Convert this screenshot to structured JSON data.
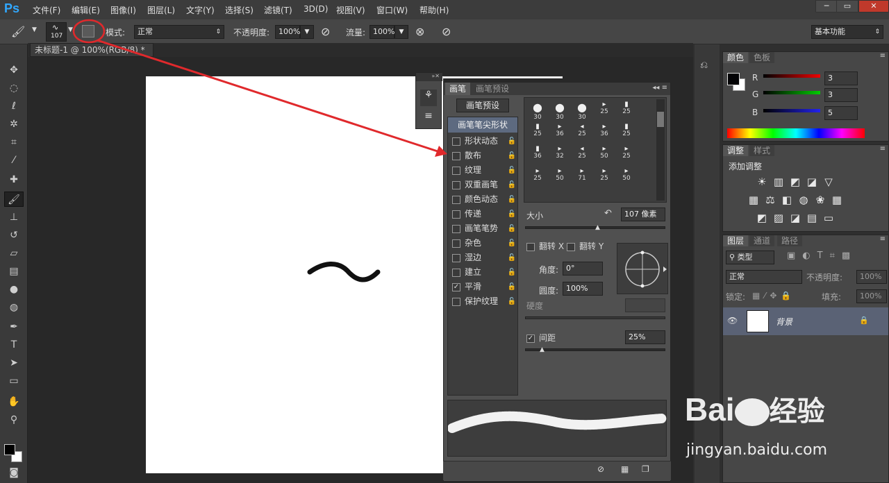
{
  "app": {
    "logo": "Ps"
  },
  "menu": [
    "文件(F)",
    "编辑(E)",
    "图像(I)",
    "图层(L)",
    "文字(Y)",
    "选择(S)",
    "滤镜(T)",
    "3D(D)",
    "视图(V)",
    "窗口(W)",
    "帮助(H)"
  ],
  "window": {
    "minimize": "─",
    "restore": "▭",
    "close": "✕"
  },
  "options": {
    "brush_size": "107",
    "mode_label": "模式:",
    "mode_value": "正常",
    "opacity_label": "不透明度:",
    "opacity_value": "100%",
    "flow_label": "流量:",
    "flow_value": "100%",
    "workspace": "基本功能"
  },
  "document": {
    "tab": "未标题-1 @ 100%(RGB/8) *"
  },
  "brush_panel": {
    "tabs": [
      "画笔",
      "画笔预设"
    ],
    "preset_button": "画笔预设",
    "tip_shape": "画笔笔尖形状",
    "items": [
      {
        "label": "形状动态",
        "checked": false
      },
      {
        "label": "散布",
        "checked": false
      },
      {
        "label": "纹理",
        "checked": false
      },
      {
        "label": "双重画笔",
        "checked": false
      },
      {
        "label": "颜色动态",
        "checked": false
      },
      {
        "label": "传递",
        "checked": false
      },
      {
        "label": "画笔笔势",
        "checked": false
      },
      {
        "label": "杂色",
        "checked": false
      },
      {
        "label": "湿边",
        "checked": false
      },
      {
        "label": "建立",
        "checked": false
      },
      {
        "label": "平滑",
        "checked": true
      },
      {
        "label": "保护纹理",
        "checked": false
      }
    ],
    "presets": [
      "30",
      "30",
      "30",
      "25",
      "25",
      "25",
      "36",
      "25",
      "36",
      "25",
      "36",
      "32",
      "25",
      "50",
      "25",
      "25",
      "50",
      "71",
      "25",
      "50"
    ],
    "size_label": "大小",
    "size_value": "107 像素",
    "flip_x": "翻转 X",
    "flip_y": "翻转 Y",
    "angle_label": "角度:",
    "angle_value": "0°",
    "roundness_label": "圆度:",
    "roundness_value": "100%",
    "hardness_label": "硬度",
    "spacing_label": "间距",
    "spacing_value": "25%"
  },
  "color_panel": {
    "tabs": [
      "颜色",
      "色板"
    ],
    "r_label": "R",
    "r": "3",
    "g_label": "G",
    "g": "3",
    "b_label": "B",
    "b": "5"
  },
  "adjust_panel": {
    "tabs": [
      "调整",
      "样式"
    ],
    "title": "添加调整"
  },
  "layers_panel": {
    "tabs": [
      "图层",
      "通道",
      "路径"
    ],
    "filter": "类型",
    "blend": "正常",
    "opacity_label": "不透明度:",
    "opacity": "100%",
    "lock_label": "锁定:",
    "fill_label": "填充:",
    "fill": "100%",
    "layer_name": "背景"
  },
  "watermark": {
    "brand": "Bai",
    "suffix": "经验",
    "url": "jingyan.baidu.com"
  },
  "colors": {
    "annotation": "#e0292c",
    "accent": "#31a8ff"
  }
}
